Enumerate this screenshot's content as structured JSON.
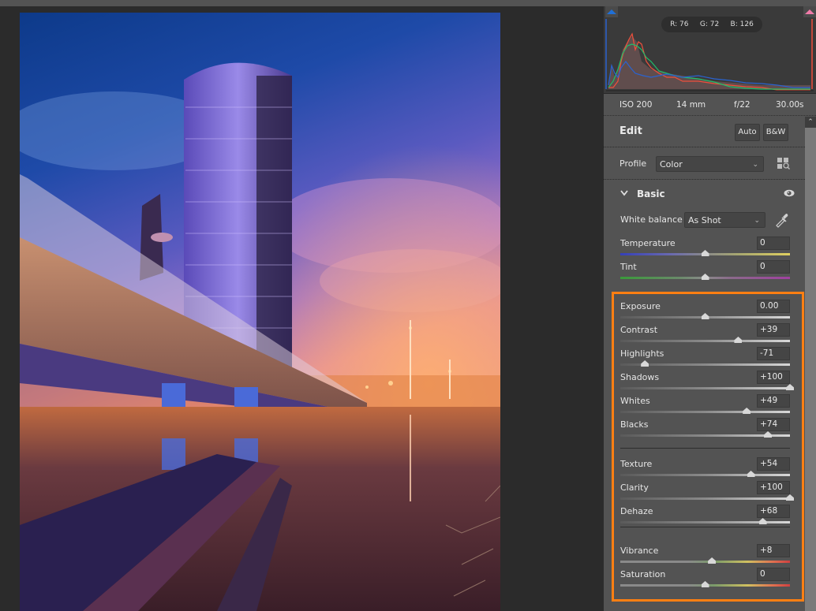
{
  "histogram": {
    "readout": {
      "r": "R: 76",
      "g": "G: 72",
      "b": "B: 126"
    },
    "clip_left_color": "#1f6fd6",
    "clip_right_color": "#f07aa8",
    "red_color": "#f0503c",
    "green_color": "#1fbf6a",
    "blue_color": "#2a63d0"
  },
  "camera_info": {
    "iso": "ISO 200",
    "focal": "14 mm",
    "aperture": "f/22",
    "shutter": "30.00s"
  },
  "edit": {
    "title": "Edit",
    "auto_label": "Auto",
    "bw_label": "B&W"
  },
  "profile": {
    "label": "Profile",
    "value": "Color"
  },
  "basic": {
    "title": "Basic",
    "white_balance": {
      "label": "White balance",
      "value": "As Shot"
    },
    "sliders": [
      {
        "name": "Temperature",
        "value": "0",
        "position": 0.5,
        "track": "temperature"
      },
      {
        "name": "Tint",
        "value": "0",
        "position": 0.5,
        "track": "tint"
      },
      {
        "name": "Exposure",
        "value": "0.00",
        "position": 0.5,
        "track": "gray"
      },
      {
        "name": "Contrast",
        "value": "+39",
        "position": 0.695,
        "track": "gray"
      },
      {
        "name": "Highlights",
        "value": "-71",
        "position": 0.145,
        "track": "gray"
      },
      {
        "name": "Shadows",
        "value": "+100",
        "position": 1.0,
        "track": "gray"
      },
      {
        "name": "Whites",
        "value": "+49",
        "position": 0.745,
        "track": "gray"
      },
      {
        "name": "Blacks",
        "value": "+74",
        "position": 0.87,
        "track": "gray"
      },
      {
        "name": "Texture",
        "value": "+54",
        "position": 0.77,
        "track": "gray"
      },
      {
        "name": "Clarity",
        "value": "+100",
        "position": 1.0,
        "track": "gray"
      },
      {
        "name": "Dehaze",
        "value": "+68",
        "position": 0.84,
        "track": "gray"
      },
      {
        "name": "Vibrance",
        "value": "+8",
        "position": 0.54,
        "track": "saturation"
      },
      {
        "name": "Saturation",
        "value": "0",
        "position": 0.5,
        "track": "saturation"
      }
    ]
  },
  "highlight_color": "#ff7f12"
}
